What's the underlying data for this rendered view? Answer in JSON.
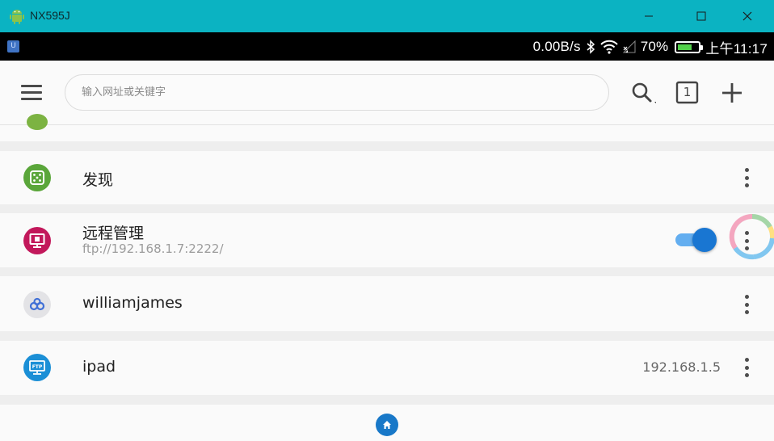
{
  "window": {
    "title": "NX595J",
    "app_icon": "android-icon",
    "buttons": [
      "minimize-icon",
      "maximize-icon",
      "close-icon"
    ]
  },
  "status_bar": {
    "notification_icon": "app-notification-icon",
    "net_speed": "0.00B/s",
    "battery_percent": "70%",
    "battery_level": 0.7,
    "time": "上午11:17",
    "icons": [
      "bluetooth-icon",
      "wifi-icon",
      "signal-icon",
      "battery-icon"
    ]
  },
  "toolbar": {
    "search_placeholder": "输入网址或关键字",
    "tabs_count": "1",
    "icons": [
      "menu-icon",
      "search-icon",
      "tabs-icon",
      "add-icon"
    ]
  },
  "list": {
    "items": [
      {
        "title": "发现",
        "icon": "dice-icon",
        "icon_color": "#5aa63a"
      },
      {
        "title": "远程管理",
        "subtitle": "ftp://192.168.1.7:2222/",
        "icon": "monitor-icon",
        "icon_color": "#c2185b",
        "toggle_on": true
      },
      {
        "title": "williamjames",
        "icon": "link-icon",
        "icon_color": "#e3e3e6"
      },
      {
        "title": "ipad",
        "right_text": "192.168.1.5",
        "icon": "ftp-icon",
        "icon_color": "#1b8fd6"
      }
    ]
  },
  "colors": {
    "window_accent": "#0bb3c2",
    "toggle_accent": "#1976d2"
  },
  "bottom": {
    "home_icon": "home-icon"
  }
}
